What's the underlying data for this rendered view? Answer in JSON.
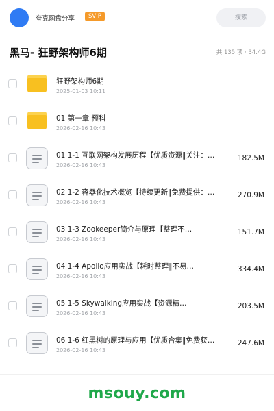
{
  "header": {
    "share_name": "夸克网盘分享",
    "svip_label": "SVIP",
    "search_label": "搜索"
  },
  "folder": {
    "title": "黑马- 狂野架构师6期",
    "summary": "共 135 项 · 34.4G"
  },
  "items": [
    {
      "type": "folder",
      "name": "狂野架构师6期",
      "date": "2025-01-03 10:11",
      "size": ""
    },
    {
      "type": "folder",
      "name": "01 第一章 预科",
      "date": "2026-02-16 10:43",
      "size": ""
    },
    {
      "type": "file",
      "name": "01 1-1 互联网架构发展历程【优质资源‖关注：…",
      "date": "2026-02-16 10:43",
      "size": "182.5M"
    },
    {
      "type": "file",
      "name": "02 1-2 容器化技术概览【持续更新‖免费提供：…",
      "date": "2026-02-16 10:43",
      "size": "270.9M"
    },
    {
      "type": "file",
      "name": "03 1-3 Zookeeper简介与原理【整理不…",
      "date": "2026-02-16 10:43",
      "size": "151.7M"
    },
    {
      "type": "file",
      "name": "04 1-4 Apollo应用实战【耗时整理‖不易…",
      "date": "2026-02-16 10:43",
      "size": "334.4M"
    },
    {
      "type": "file",
      "name": "05 1-5 Skywalking应用实战【资源精…",
      "date": "2026-02-16 10:43",
      "size": "203.5M"
    },
    {
      "type": "file",
      "name": "06 1-6 红黑树的原理与应用【优质合集‖免费获…",
      "date": "2026-02-16 10:43",
      "size": "247.6M"
    }
  ],
  "watermark": "msouy.com",
  "colors": {
    "avatar": "#2f7bf4",
    "svip_badge": "#f59a2a",
    "folder_yellow": "#f8c020",
    "watermark_green": "#1fa84a"
  }
}
